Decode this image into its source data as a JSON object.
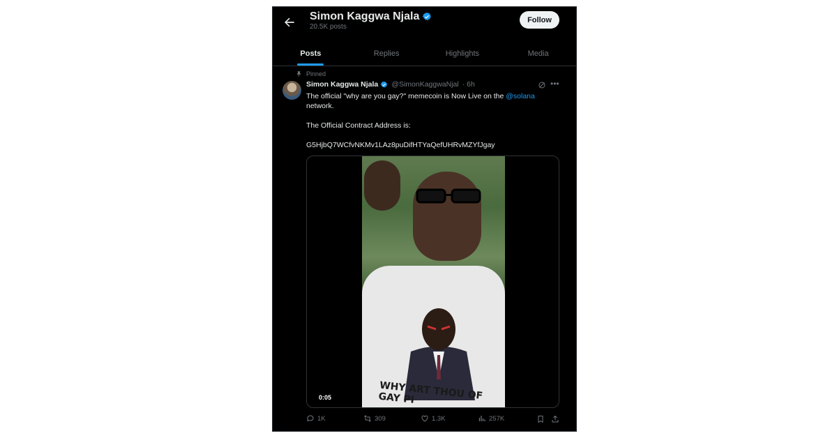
{
  "header": {
    "name": "Simon Kaggwa Njala",
    "posts_count": "20.5K posts",
    "follow_label": "Follow"
  },
  "tabs": [
    {
      "label": "Posts",
      "active": true
    },
    {
      "label": "Replies",
      "active": false
    },
    {
      "label": "Highlights",
      "active": false
    },
    {
      "label": "Media",
      "active": false
    }
  ],
  "post": {
    "pinned_label": "Pinned",
    "author": "Simon Kaggwa Njala",
    "handle": "@SimonKaggwaNjal",
    "time": "· 6h",
    "text_line1_a": "The official \"why are you gay?\" memecoin is Now Live on the ",
    "mention": "@solana",
    "text_line2": "network.",
    "text_line3": "The Official Contract Address is:",
    "contract": "G5HjbQ7WCfvNKMv1LAz8puDifHTYaQefUHRvMZYfJgay",
    "video_time": "0:05",
    "shirt_text": "WHY ART THOU OF GAY PI",
    "replies": "1K",
    "reposts": "309",
    "likes": "1.3K",
    "views": "257K"
  },
  "colors": {
    "accent": "#1d9bf0",
    "background": "#000000",
    "muted": "#71767b"
  }
}
